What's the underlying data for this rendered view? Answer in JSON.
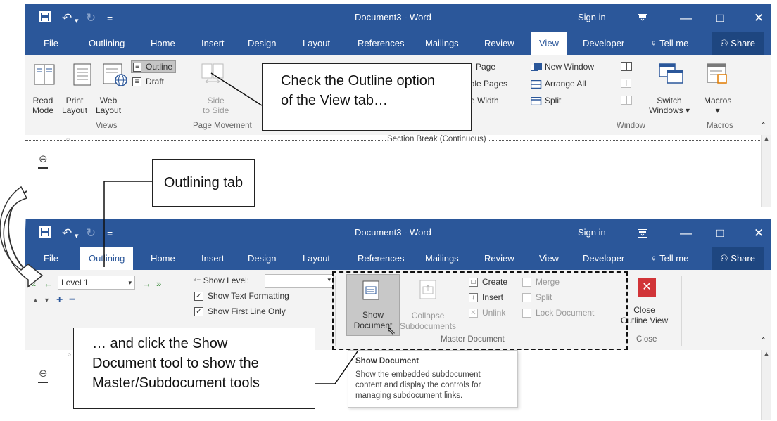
{
  "window": {
    "doc_title": "Document3 - Word",
    "sign_in": "Sign in",
    "share": "Share",
    "tell_me": "Tell me",
    "quick_access": {
      "save": "💾",
      "undo": "↶",
      "redo": "↻",
      "customize": "="
    },
    "controls": {
      "restore": "☐",
      "minimize": "—",
      "maximize": "□",
      "close": "✕"
    }
  },
  "tabs_top": [
    "File",
    "Outlining",
    "Home",
    "Insert",
    "Design",
    "Layout",
    "References",
    "Mailings",
    "Review",
    "View",
    "Developer"
  ],
  "tabs_bottom": [
    "File",
    "Outlining",
    "Home",
    "Insert",
    "Design",
    "Layout",
    "References",
    "Mailings",
    "Review",
    "View",
    "Developer"
  ],
  "view_ribbon": {
    "read_mode": [
      "Read",
      "Mode"
    ],
    "print_layout": [
      "Print",
      "Layout"
    ],
    "web_layout": [
      "Web",
      "Layout"
    ],
    "outline": "Outline",
    "draft": "Draft",
    "views_group": "Views",
    "side_to_side": [
      "Side",
      "to Side"
    ],
    "page_movement_group": "Page Movement",
    "page": "Page",
    "multiple_pages": "iple Pages",
    "page_width": "e Width",
    "new_window": "New Window",
    "arrange_all": "Arrange All",
    "split": "Split",
    "switch_windows": [
      "Switch",
      "Windows ▾"
    ],
    "window_group": "Window",
    "macros": "Macros",
    "macros_group": "Macros"
  },
  "section_break": "Section Break (Continuous)",
  "outlining_ribbon": {
    "level_value": "Level 1",
    "show_level": "Show Level:",
    "show_text_formatting": "Show Text Formatting",
    "show_first_line": "Show First Line Only",
    "show_document": [
      "Show",
      "Document"
    ],
    "collapse_subdocuments": [
      "Collapse",
      "Subdocuments"
    ],
    "create": "Create",
    "insert": "Insert",
    "unlink": "Unlink",
    "merge": "Merge",
    "split": "Split",
    "lock_document": "Lock Document",
    "master_document_group": "Master Document",
    "close_outline": [
      "Close",
      "Outline View"
    ],
    "close_group": "Close"
  },
  "tooltip": {
    "title": "Show Document",
    "body": [
      "Show the embedded subdocument",
      "content and display the controls for",
      "managing subdocument links."
    ]
  },
  "callouts": {
    "view_tab": [
      "Check the Outline option",
      "of the View tab…"
    ],
    "outlining_tab": "Outlining tab",
    "show_document": [
      "… and click the Show",
      "Document tool to show the",
      "Master/Subdocument tools"
    ]
  },
  "colors": {
    "word_blue": "#2b579a",
    "close_red": "#d13438"
  }
}
